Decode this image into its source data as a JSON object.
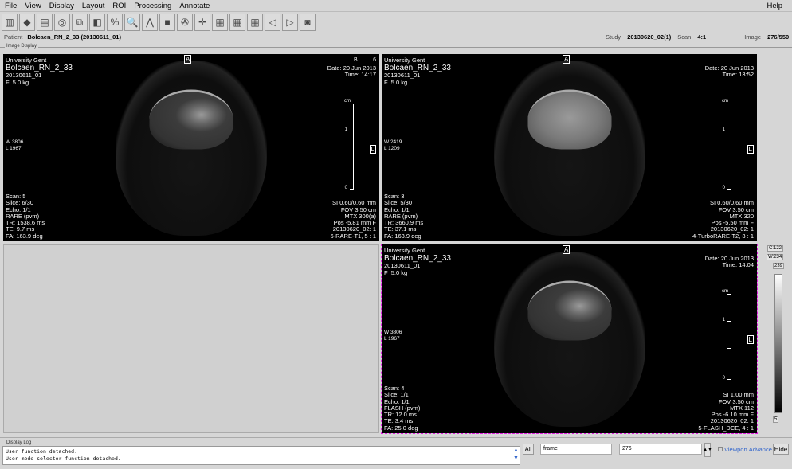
{
  "menu": [
    "File",
    "View",
    "Display",
    "Layout",
    "ROI",
    "Processing",
    "Annotate"
  ],
  "help": "Help",
  "toolbar_icons": [
    "library-icon",
    "book-icon",
    "atlas-icon",
    "disc-icon",
    "hierarchy-icon",
    "contrast-icon",
    "percent-icon",
    "zoom-icon",
    "caliper-icon",
    "cube-icon",
    "camera-tripod-icon",
    "crosshair-icon",
    "colormap-icon",
    "layout-2x2-icon",
    "layout-grid-icon",
    "prev-frame-icon",
    "next-frame-icon",
    "snapshot-icon"
  ],
  "patient": {
    "label": "Patient",
    "value": "Bolcaen_RN_2_33 (20130611_01)"
  },
  "study": {
    "study_label": "Study",
    "study_value": "20130620_02(1)",
    "scan_label": "Scan",
    "scan_value": "4:1",
    "image_label": "Image",
    "image_value": "276/550"
  },
  "image_display_label": "Image Display",
  "viewports": [
    {
      "inst": "University Gent",
      "name": "Bolcaen_RN_2_33",
      "id": "20130611_01\nF  5.0 kg",
      "date": "Date: 20 Jun 2013\nTime: 14:17",
      "wl": "W 3806\nL 1967",
      "bl": "Scan: 5\nSlice: 6/30\nEcho: 1/1\nRARE (pvm)\nTR: 1538.6 ms\nTE: 9.7 ms\nFA: 163.9 deg",
      "br": "SI 0.60/0.60 mm\nFOV 3.50 cm\nMTX 300(a)\nPos -5.81 mm F\n20130620_02: 1\n6-RARE-T1, 5 : 1",
      "extra": "B          6"
    },
    {
      "inst": "University Gent",
      "name": "Bolcaen_RN_2_33",
      "id": "20130611_01\nF  5.0 kg",
      "date": "Date: 20 Jun 2013\nTime: 13:52",
      "wl": "W 2419\nL 1209",
      "bl": "Scan: 3\nSlice: 5/30\nEcho: 1/1\nRARE (pvm)\nTR: 3660.9 ms\nTE: 37.1 ms\nFA: 163.9 deg",
      "br": "SI 0.60/0.60 mm\nFOV 3.50 cm\nMTX 320\nPos -5.50 mm F\n20130620_02: 1\n4-TurboRARE-T2, 3 : 1",
      "extra": ""
    },
    {
      "inst": "University Gent",
      "name": "Bolcaen_RN_2_33",
      "id": "20130611_01\nF  5.0 kg",
      "date": "Date: 20 Jun 2013\nTime: 14:04",
      "wl": "W 3806\nL 1967",
      "bl": "Scan: 4\nSlice: 1/1\nEcho: 1/1\nFLASH (pvm)\nTR: 12.0 ms\nTE: 3.4 ms\nFA: 25.0 deg",
      "br": "SI 1.00 mm\nFOV 3.50 cm\nMTX 112\nPos -6.10 mm F\n20130620_02: 1\n5-FLASH_DCE, 4 : 1",
      "extra": ""
    }
  ],
  "orient": {
    "top": "A",
    "side": "L"
  },
  "scale": {
    "unit": "cm",
    "t1": "1",
    "t0": "0"
  },
  "colorbar": {
    "c": "C:122",
    "w": "W:234",
    "max": "239",
    "min": "5"
  },
  "log": {
    "label": "Display Log",
    "lines": [
      "User function detached.",
      "User mode selector function detached."
    ]
  },
  "controls": {
    "all": "All",
    "frame": "frame",
    "frame_value": "276",
    "viewport_advance": "Viewport Advance",
    "hide": "Hide"
  }
}
